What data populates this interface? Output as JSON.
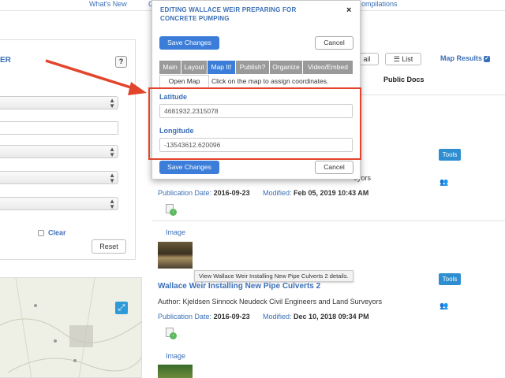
{
  "topnav": {
    "whats_new": "What's New",
    "c_fragment": "C",
    "compilations": "ompilations"
  },
  "left_panel": {
    "title": "ER",
    "help": "?",
    "clear_label": "Clear",
    "reset_label": "Reset"
  },
  "map_widget": {
    "expand_icon": "⤢"
  },
  "results_header": {
    "email_tab": "ail",
    "list_tab": "List",
    "list_icon": "list-icon",
    "map_results": "Map Results",
    "public_docs": "Public Docs"
  },
  "results": [
    {
      "author_suffix": "eyors",
      "tools": "Tools",
      "pub_label": "Publication Date:",
      "pub_date": "2016-09-23",
      "mod_label": "Modified:",
      "mod_date": "Feb 05, 2019 10:43 AM",
      "type": "Image"
    },
    {
      "title": "Wallace Weir Installing New Pipe Culverts 2",
      "tooltip": "View Wallace Weir Installing New Pipe Culverts 2 details.",
      "tools": "Tools",
      "author": "Author: Kjeldsen Sinnock Neudeck Civil Engineers and Land Surveyors",
      "pub_label": "Publication Date:",
      "pub_date": "2016-09-23",
      "mod_label": "Modified:",
      "mod_date": "Dec 10, 2018 09:34 PM",
      "type": "Image"
    }
  ],
  "modal": {
    "title": "EDITING WALLACE WEIR PREPARING FOR CONCRETE PUMPING",
    "close": "×",
    "save": "Save Changes",
    "cancel": "Cancel",
    "tabs": [
      "Main",
      "Layout",
      "Map It!",
      "Publish?",
      "Organize",
      "Video/Embed"
    ],
    "active_tab": "Map It!",
    "open_map": "Open Map",
    "hint": "Click on the map to assign coordinates.",
    "latitude_label": "Latitude",
    "latitude_value": "4681932.2315078",
    "longitude_label": "Longitude",
    "longitude_value": "-13543612.620096"
  },
  "colors": {
    "accent": "#3b7dd8",
    "annotation": "#e2452b",
    "link": "#3b6fb6"
  }
}
